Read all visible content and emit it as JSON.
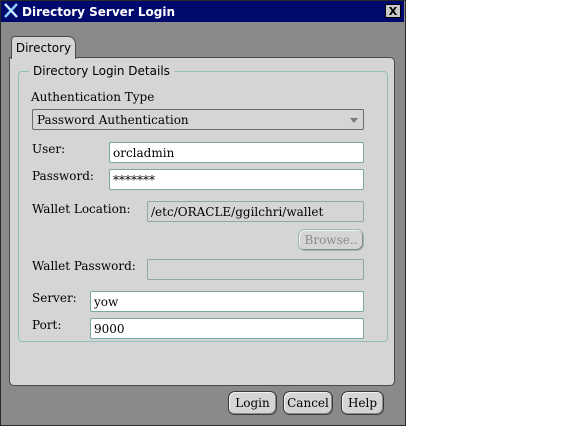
{
  "window": {
    "title": "Directory Server Login",
    "close_label": "X"
  },
  "tab": {
    "label": "Directory"
  },
  "group": {
    "label": "Directory Login Details"
  },
  "auth": {
    "label": "Authentication Type",
    "selected": "Password Authentication"
  },
  "user": {
    "label": "User:",
    "value": "orcladmin"
  },
  "password": {
    "label": "Password:",
    "value": "*******"
  },
  "wallet_location": {
    "label": "Wallet Location:",
    "value": "/etc/ORACLE/ggilchri/wallet"
  },
  "browse": {
    "label": "Browse.."
  },
  "wallet_password": {
    "label": "Wallet Password:",
    "value": ""
  },
  "server": {
    "label": "Server:",
    "value": "yow"
  },
  "port": {
    "label": "Port:",
    "value": "9000"
  },
  "buttons": {
    "login": "Login",
    "cancel": "Cancel",
    "help": "Help"
  },
  "colors": {
    "titlebar": "#000a6e",
    "panel": "#d5d5d5",
    "frame": "#8a8a8a",
    "field_border": "#7aa8a0"
  },
  "icons": {
    "app": "x-window-icon",
    "close": "close-icon",
    "dropdown": "chevron-down-icon"
  }
}
